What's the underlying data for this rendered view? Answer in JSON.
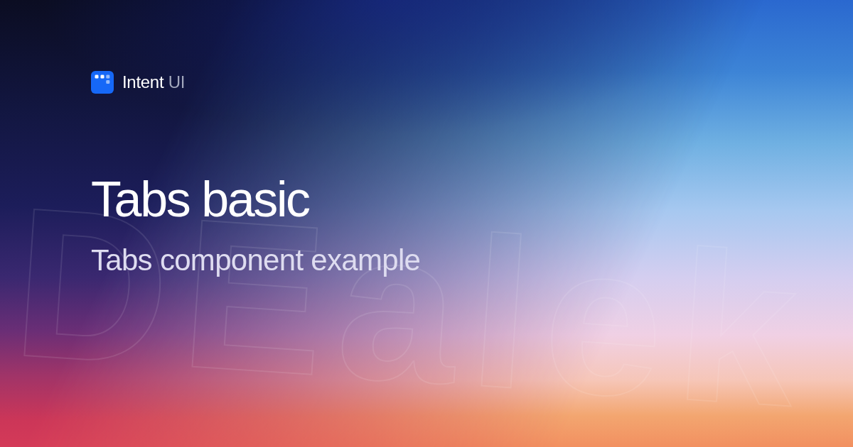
{
  "brand": {
    "name": "Intent",
    "suffix": "UI"
  },
  "backdrop_text": "DEalek",
  "title": "Tabs basic",
  "subtitle": "Tabs component example"
}
